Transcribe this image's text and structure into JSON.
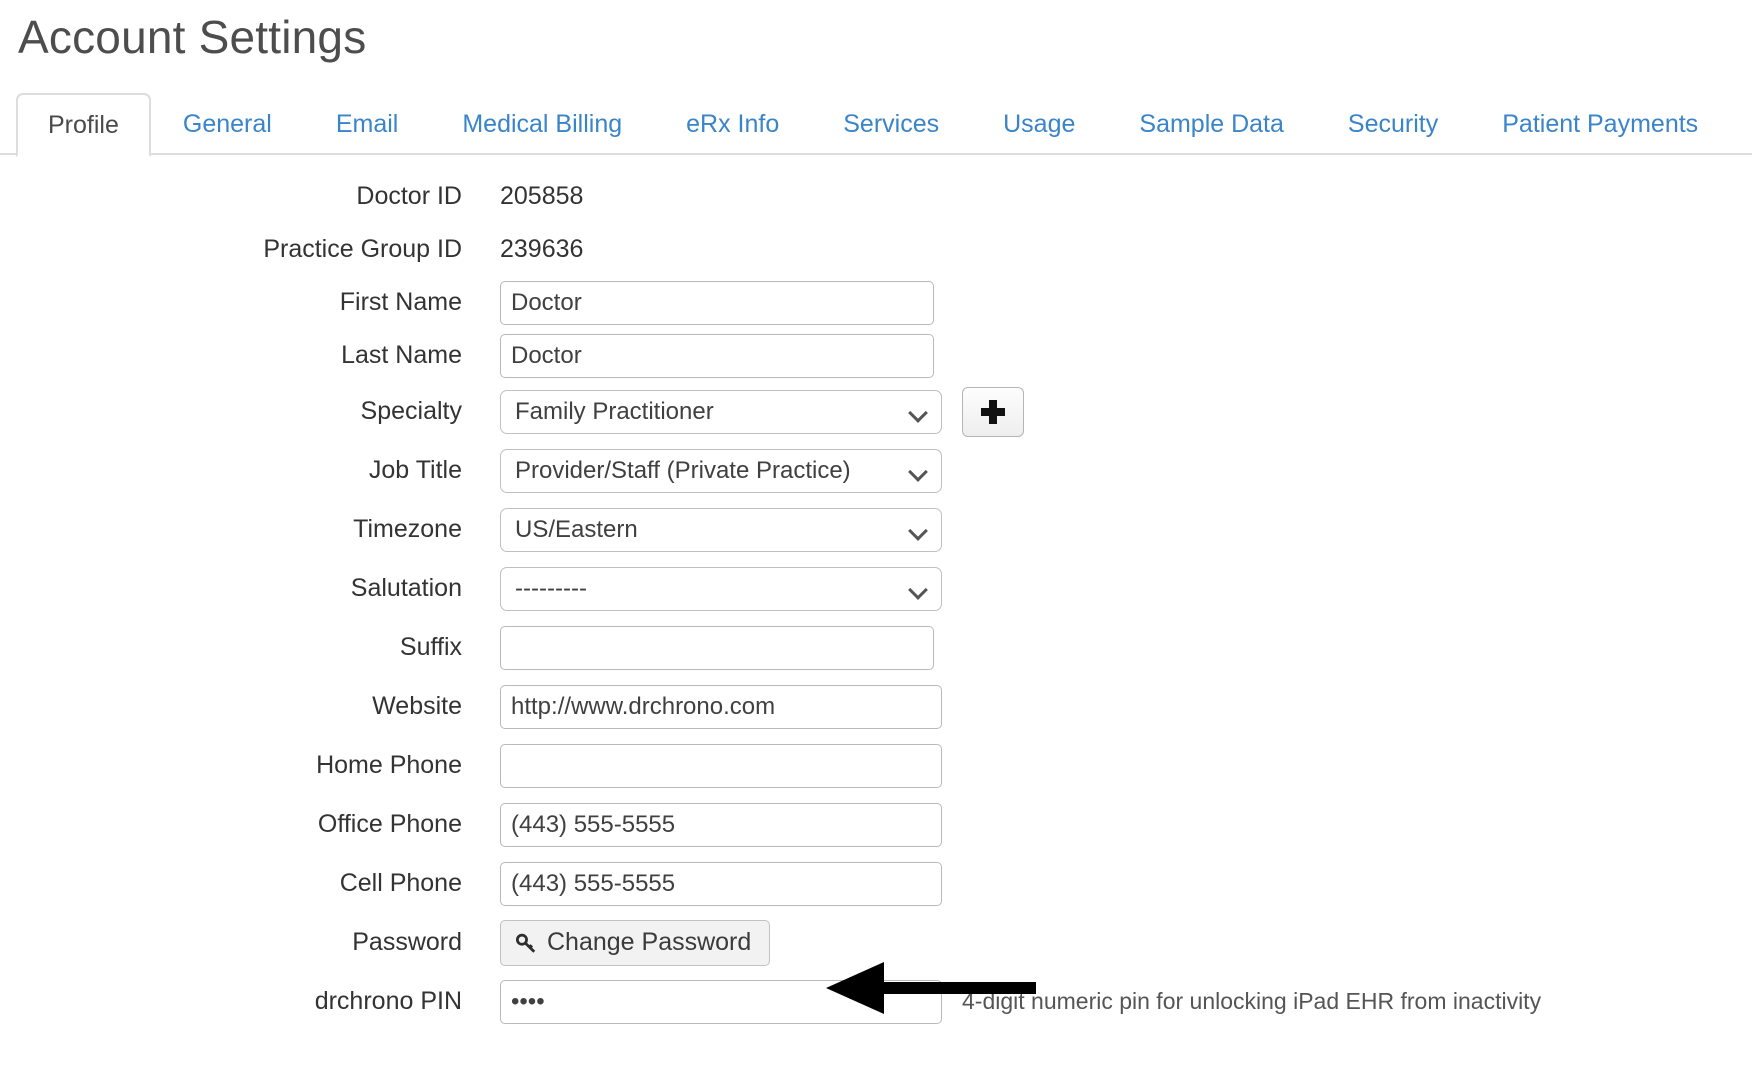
{
  "page": {
    "title": "Account Settings"
  },
  "tabs": [
    {
      "label": "Profile",
      "active": true
    },
    {
      "label": "General",
      "active": false
    },
    {
      "label": "Email",
      "active": false
    },
    {
      "label": "Medical Billing",
      "active": false
    },
    {
      "label": "eRx Info",
      "active": false
    },
    {
      "label": "Services",
      "active": false
    },
    {
      "label": "Usage",
      "active": false
    },
    {
      "label": "Sample Data",
      "active": false
    },
    {
      "label": "Security",
      "active": false
    },
    {
      "label": "Patient Payments",
      "active": false
    }
  ],
  "form": {
    "doctor_id": {
      "label": "Doctor ID",
      "value": "205858"
    },
    "practice_group_id": {
      "label": "Practice Group ID",
      "value": "239636"
    },
    "first_name": {
      "label": "First Name",
      "value": "Doctor",
      "placeholder": ""
    },
    "last_name": {
      "label": "Last Name",
      "value": "Doctor",
      "placeholder": ""
    },
    "specialty": {
      "label": "Specialty",
      "value": "Family Practitioner",
      "add_button": "+"
    },
    "job_title": {
      "label": "Job Title",
      "value": "Provider/Staff (Private Practice)"
    },
    "timezone": {
      "label": "Timezone",
      "value": "US/Eastern"
    },
    "salutation": {
      "label": "Salutation",
      "value": "---------"
    },
    "suffix": {
      "label": "Suffix",
      "value": "",
      "placeholder": ""
    },
    "website": {
      "label": "Website",
      "value": "http://www.drchrono.com",
      "placeholder": ""
    },
    "home_phone": {
      "label": "Home Phone",
      "value": "",
      "placeholder": ""
    },
    "office_phone": {
      "label": "Office Phone",
      "value": "(443) 555-5555",
      "placeholder": ""
    },
    "cell_phone": {
      "label": "Cell Phone",
      "value": "(443) 555-5555",
      "placeholder": ""
    },
    "password": {
      "label": "Password",
      "button_label": "Change Password",
      "icon": "key-icon"
    },
    "drchrono_pin": {
      "label": "drchrono PIN",
      "value": "••••",
      "placeholder": "",
      "hint": "4-digit numeric pin for unlocking iPad EHR from inactivity"
    }
  },
  "annotation": {
    "arrow": "left-pointing-arrow",
    "points_to": "Change Password"
  },
  "colors": {
    "tab_link": "#3a84c9",
    "tab_active_text": "#4a4a4a",
    "title_text": "#4d4d4d",
    "border": "#dddddd",
    "input_border": "#b9b9b9",
    "button_face": "#f2f2f2",
    "arrow": "#000000"
  }
}
